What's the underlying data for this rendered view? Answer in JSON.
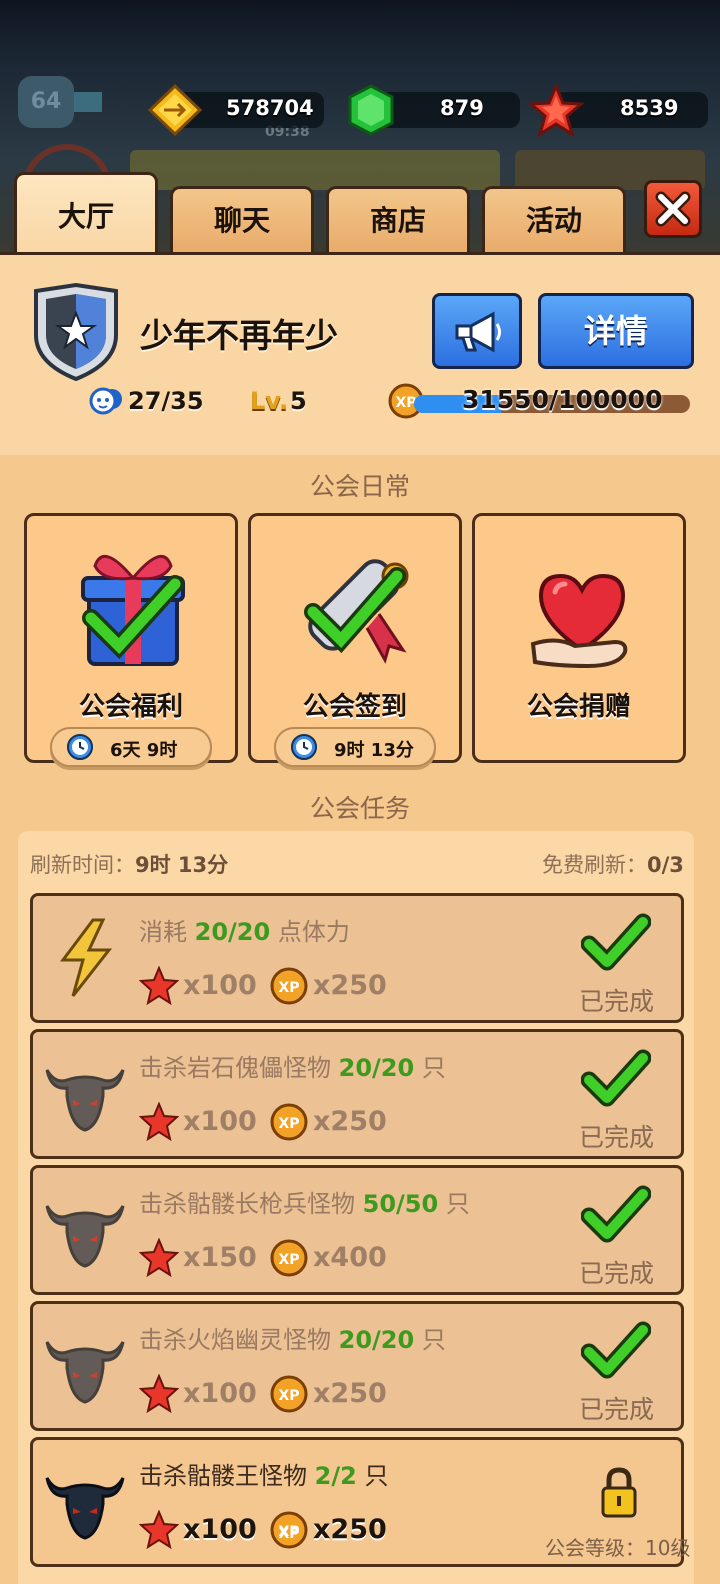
{
  "currency": {
    "gold": "578704",
    "gems": "879",
    "stars": "8539"
  },
  "background": {
    "level": "64",
    "timer": "09:38"
  },
  "tabs": [
    "大厅",
    "聊天",
    "商店",
    "活动"
  ],
  "guild": {
    "name": "少年不再年少",
    "members": "27/35",
    "level_prefix": "Lv.",
    "level": "5",
    "xp_text": "31550/100000",
    "xp_progress": 0.3155,
    "details_label": "详情"
  },
  "daily": {
    "title": "公会日常",
    "items": [
      {
        "label": "公会福利",
        "timer": "6天 9时"
      },
      {
        "label": "公会签到",
        "timer": "9时 13分"
      },
      {
        "label": "公会捐赠"
      }
    ]
  },
  "tasks": {
    "title": "公会任务",
    "refresh_label": "刷新时间：",
    "refresh_time": "9时 13分",
    "free_label": "免费刷新：",
    "free_count": "0/3",
    "items": [
      {
        "pre": "消耗 ",
        "progress": "20/20",
        "post": " 点体力",
        "star": "x100",
        "xp": "x250",
        "status": "已完成"
      },
      {
        "pre": "击杀岩石傀儡怪物 ",
        "progress": "20/20",
        "post": " 只",
        "star": "x100",
        "xp": "x250",
        "status": "已完成"
      },
      {
        "pre": "击杀骷髅长枪兵怪物 ",
        "progress": "50/50",
        "post": " 只",
        "star": "x150",
        "xp": "x400",
        "status": "已完成"
      },
      {
        "pre": "击杀火焰幽灵怪物 ",
        "progress": "20/20",
        "post": " 只",
        "star": "x100",
        "xp": "x250",
        "status": "已完成"
      },
      {
        "pre": "击杀骷髅王怪物 ",
        "progress": "2/2",
        "post": " 只",
        "star": "x100",
        "xp": "x250",
        "requirement": "公会等级：10级"
      }
    ]
  },
  "colors": {
    "panel": "#f5c88e",
    "accent_blue": "#2d6fe0",
    "progress_green": "#3c9a1e"
  }
}
